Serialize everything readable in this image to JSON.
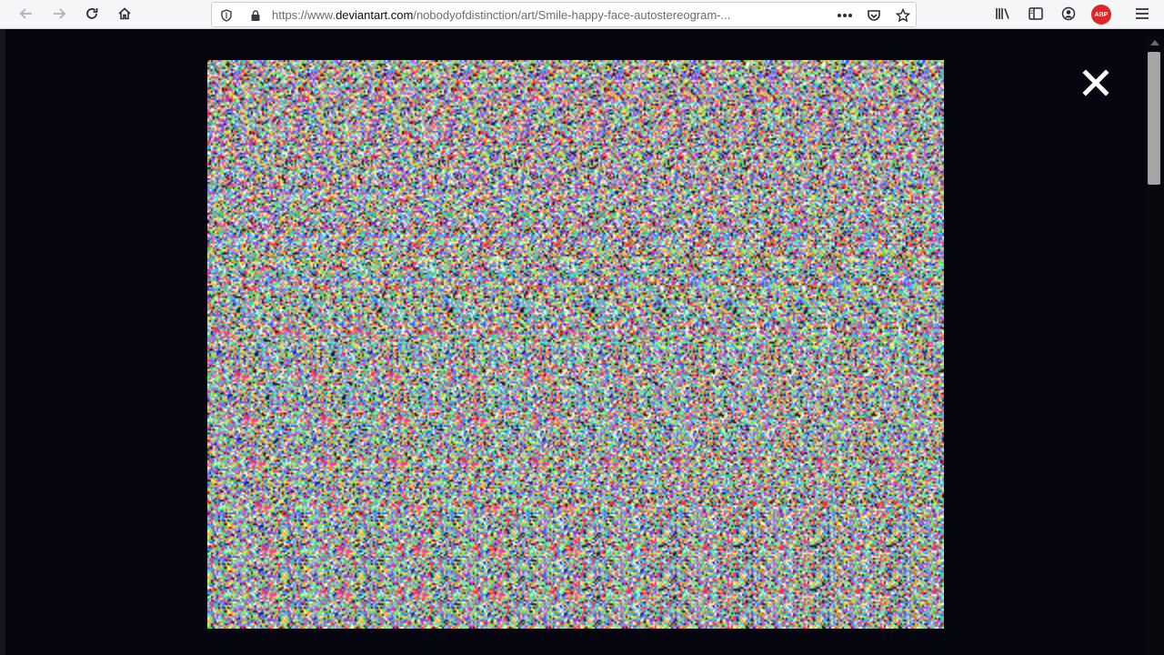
{
  "browser": {
    "url": {
      "prefix": "https://www.",
      "host": "deviantart.com",
      "path": "/nobodyofdistinction/art/Smile-happy-face-autostereogram-..."
    },
    "icons": {
      "back": "back-arrow-icon",
      "forward": "forward-arrow-icon",
      "reload": "reload-icon",
      "home": "home-icon",
      "tracking": "shield-icon",
      "lock": "lock-icon",
      "page_actions": "more-dots-icon",
      "pocket": "pocket-icon",
      "bookmark": "star-icon",
      "library": "library-icon",
      "sidebar": "sidebar-icon",
      "account": "account-icon",
      "menu": "hamburger-menu-icon"
    },
    "adblock_badge": "ABP"
  },
  "viewer": {
    "image_subject": "autostereogram",
    "close_icon": "close-icon",
    "background_color": "#05050f"
  }
}
